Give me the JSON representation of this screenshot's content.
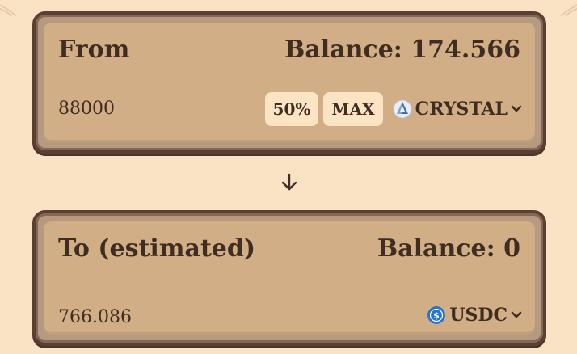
{
  "from_panel": {
    "title": "From",
    "balance_text": "Balance: 174.566",
    "amount": "88000",
    "half_label": "50%",
    "max_label": "MAX",
    "token": "CRYSTAL",
    "token_icon": "crystal-icon"
  },
  "swap_arrow": {
    "icon": "arrow-down-icon"
  },
  "to_panel": {
    "title": "To (estimated)",
    "balance_text": "Balance: 0",
    "amount": "766.086",
    "token": "USDC",
    "token_icon": "usdc-icon"
  },
  "colors": {
    "page_bg": "#fae3c5",
    "panel_border": "#5a4034",
    "panel_inner": "#d2ae87",
    "pill_bg": "#fae4c4",
    "text": "#3f2d21",
    "usdc_blue": "#2775ca"
  }
}
